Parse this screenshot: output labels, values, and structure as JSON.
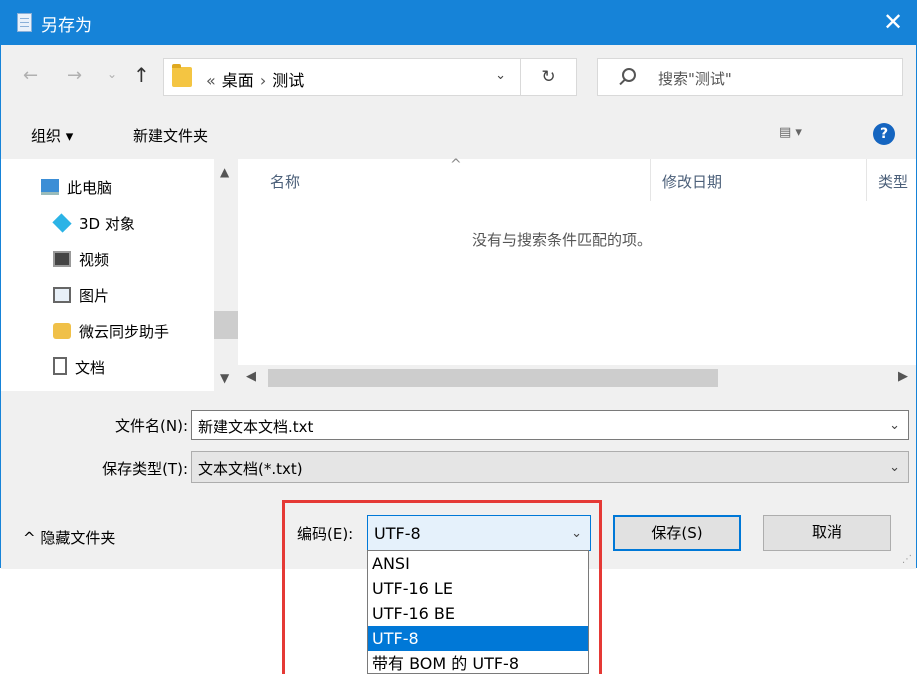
{
  "window": {
    "title": "另存为",
    "close_label": "✕"
  },
  "address": {
    "back": "←",
    "forward": "→",
    "recent": "⌄",
    "up": "↑",
    "crumbs": [
      "«",
      "桌面",
      "›",
      "测试"
    ],
    "dropdown": "⌄",
    "refresh": "↻"
  },
  "search": {
    "placeholder": "搜索\"测试\""
  },
  "toolbar": {
    "organize": "组织 ▾",
    "new_folder": "新建文件夹",
    "view": "▤ ▾",
    "help": "?"
  },
  "sidebar": {
    "items": [
      {
        "label": "此电脑",
        "icon": "computer-icon"
      },
      {
        "label": "3D 对象",
        "icon": "3d-objects-icon"
      },
      {
        "label": "视频",
        "icon": "video-icon"
      },
      {
        "label": "图片",
        "icon": "pictures-icon"
      },
      {
        "label": "微云同步助手",
        "icon": "cloud-sync-icon"
      },
      {
        "label": "文档",
        "icon": "documents-icon"
      }
    ]
  },
  "files": {
    "columns": [
      "名称",
      "修改日期",
      "类型"
    ],
    "empty_message": "没有与搜索条件匹配的项。"
  },
  "form": {
    "filename_label": "文件名(N):",
    "filename_value": "新建文本文档.txt",
    "type_label": "保存类型(T):",
    "type_value": "文本文档(*.txt)",
    "hide_folders": "^ 隐藏文件夹",
    "encoding_label": "编码(E):",
    "encoding_value": "UTF-8",
    "save_label": "保存(S)",
    "cancel_label": "取消"
  },
  "encoding_options": [
    "ANSI",
    "UTF-16 LE",
    "UTF-16 BE",
    "UTF-8",
    "带有 BOM 的 UTF-8"
  ],
  "encoding_selected": "UTF-8",
  "colors": {
    "accent": "#1683d8",
    "selection": "#0078d7",
    "highlight_box": "#e53935"
  }
}
